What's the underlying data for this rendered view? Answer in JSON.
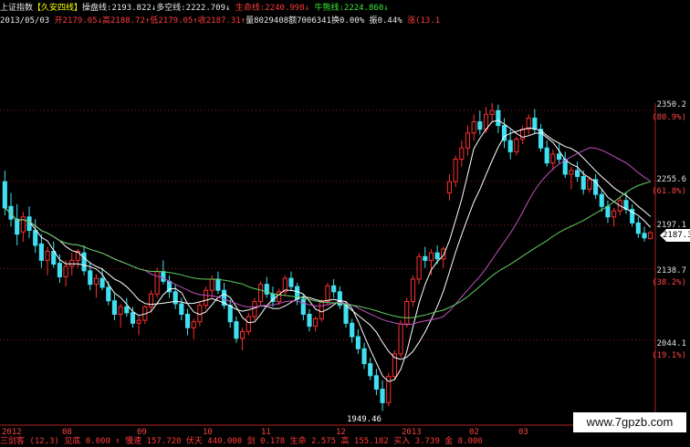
{
  "header": {
    "index_name": "上证指数",
    "formula": "【久安四线】",
    "line1_label": "操盘线:",
    "line1_value": "2193.822",
    "arrow_down": "↓",
    "line2_label": "多空线:",
    "line2_value": "2222.709",
    "line3_label": "生命线:",
    "line3_value": "2240.998",
    "line4_label": "牛熊线:",
    "line4_value": "2224.860"
  },
  "quote": {
    "date": "2013/05/03",
    "open_label": "开",
    "open": "2179.05",
    "high_label": "高",
    "high": "2188.72",
    "low_label": "低",
    "low": "2179.05",
    "close_label": "收",
    "close": "2187.31",
    "vol_label": "量",
    "vol": "8029408",
    "amt_label": "额",
    "amt": "7006341",
    "turn_label": "换",
    "turn": "0.00%",
    "amp_label": "振",
    "amp": "0.44%",
    "chg_label": "涨",
    "chg": "(13.1"
  },
  "y_axis": [
    {
      "price": "2350.2",
      "pct": "(80.9%)"
    },
    {
      "price": "2255.6",
      "pct": "(61.8%)"
    },
    {
      "price": "2197.1"
    },
    {
      "price": "2138.7",
      "pct": "(38.2%)"
    },
    {
      "price": "2044.1",
      "pct": "(19.1%)"
    }
  ],
  "current_price": "2187.3",
  "low_annotation": "1949.46",
  "x_axis": [
    "2012",
    "08",
    "09",
    "10",
    "11",
    "12",
    "2013",
    "02",
    "03"
  ],
  "bottom_text": "三剑客 (12,3)  见底 0.000 ↑  慢速 157.720  伏天 440.000  剑 0.178  生命 2.575  高 155.182  买入 3.739  金 8.000",
  "watermark": "www.7gpzb.com",
  "colors": {
    "up": "#ff3030",
    "down": "#40e0f0",
    "ma_white": "#ffffff",
    "ma_magenta": "#c050c0",
    "ma_green": "#60d060"
  },
  "chart_data": {
    "type": "candlestick",
    "ylim": [
      1930,
      2360
    ],
    "x_ticks": [
      "2012",
      "08",
      "09",
      "10",
      "11",
      "12",
      "2013",
      "02",
      "03"
    ],
    "candles": [
      [
        2255,
        2270,
        2210,
        2220
      ],
      [
        2222,
        2240,
        2195,
        2205
      ],
      [
        2205,
        2225,
        2170,
        2185
      ],
      [
        2188,
        2215,
        2175,
        2208
      ],
      [
        2208,
        2222,
        2180,
        2190
      ],
      [
        2190,
        2205,
        2160,
        2170
      ],
      [
        2172,
        2185,
        2140,
        2150
      ],
      [
        2150,
        2168,
        2130,
        2162
      ],
      [
        2162,
        2175,
        2140,
        2145
      ],
      [
        2146,
        2158,
        2120,
        2128
      ],
      [
        2128,
        2150,
        2115,
        2142
      ],
      [
        2142,
        2160,
        2130,
        2150
      ],
      [
        2150,
        2165,
        2140,
        2162
      ],
      [
        2160,
        2170,
        2130,
        2136
      ],
      [
        2136,
        2148,
        2110,
        2118
      ],
      [
        2118,
        2132,
        2100,
        2126
      ],
      [
        2126,
        2140,
        2110,
        2114
      ],
      [
        2114,
        2122,
        2090,
        2096
      ],
      [
        2096,
        2105,
        2070,
        2078
      ],
      [
        2078,
        2092,
        2060,
        2088
      ],
      [
        2088,
        2100,
        2075,
        2080
      ],
      [
        2080,
        2088,
        2060,
        2066
      ],
      [
        2066,
        2075,
        2050,
        2070
      ],
      [
        2070,
        2090,
        2065,
        2088
      ],
      [
        2088,
        2110,
        2080,
        2105
      ],
      [
        2105,
        2140,
        2100,
        2135
      ],
      [
        2135,
        2150,
        2118,
        2122
      ],
      [
        2122,
        2130,
        2100,
        2108
      ],
      [
        2108,
        2118,
        2085,
        2092
      ],
      [
        2092,
        2100,
        2070,
        2078
      ],
      [
        2078,
        2085,
        2050,
        2060
      ],
      [
        2060,
        2072,
        2045,
        2068
      ],
      [
        2068,
        2095,
        2062,
        2090
      ],
      [
        2090,
        2115,
        2085,
        2110
      ],
      [
        2110,
        2130,
        2100,
        2125
      ],
      [
        2125,
        2135,
        2105,
        2110
      ],
      [
        2110,
        2120,
        2085,
        2090
      ],
      [
        2090,
        2098,
        2060,
        2068
      ],
      [
        2068,
        2075,
        2040,
        2046
      ],
      [
        2046,
        2060,
        2030,
        2055
      ],
      [
        2055,
        2080,
        2050,
        2075
      ],
      [
        2075,
        2100,
        2070,
        2095
      ],
      [
        2095,
        2122,
        2090,
        2118
      ],
      [
        2118,
        2128,
        2100,
        2105
      ],
      [
        2105,
        2115,
        2088,
        2095
      ],
      [
        2095,
        2112,
        2090,
        2108
      ],
      [
        2108,
        2130,
        2102,
        2126
      ],
      [
        2126,
        2135,
        2110,
        2115
      ],
      [
        2115,
        2120,
        2090,
        2098
      ],
      [
        2098,
        2105,
        2070,
        2078
      ],
      [
        2078,
        2085,
        2055,
        2062
      ],
      [
        2062,
        2075,
        2055,
        2072
      ],
      [
        2072,
        2098,
        2068,
        2095
      ],
      [
        2095,
        2120,
        2090,
        2116
      ],
      [
        2116,
        2125,
        2100,
        2108
      ],
      [
        2108,
        2115,
        2085,
        2090
      ],
      [
        2090,
        2095,
        2060,
        2066
      ],
      [
        2066,
        2072,
        2040,
        2048
      ],
      [
        2048,
        2058,
        2025,
        2032
      ],
      [
        2032,
        2040,
        2005,
        2012
      ],
      [
        2012,
        2020,
        1990,
        1996
      ],
      [
        1996,
        2005,
        1970,
        1978
      ],
      [
        1978,
        1990,
        1949,
        1960
      ],
      [
        1960,
        2000,
        1955,
        1995
      ],
      [
        1995,
        2030,
        1990,
        2025
      ],
      [
        2025,
        2070,
        2020,
        2065
      ],
      [
        2065,
        2100,
        2060,
        2095
      ],
      [
        2095,
        2130,
        2088,
        2125
      ],
      [
        2125,
        2160,
        2118,
        2155
      ],
      [
        2155,
        2168,
        2140,
        2150
      ],
      [
        2150,
        2165,
        2130,
        2160
      ],
      [
        2160,
        2170,
        2145,
        2152
      ],
      [
        2152,
        2168,
        2140,
        2165
      ],
      [
        2240,
        2265,
        2230,
        2255
      ],
      [
        2255,
        2290,
        2248,
        2285
      ],
      [
        2285,
        2310,
        2275,
        2300
      ],
      [
        2300,
        2330,
        2290,
        2320
      ],
      [
        2320,
        2345,
        2310,
        2335
      ],
      [
        2335,
        2350,
        2318,
        2325
      ],
      [
        2325,
        2355,
        2320,
        2345
      ],
      [
        2345,
        2360,
        2335,
        2350
      ],
      [
        2350,
        2358,
        2320,
        2330
      ],
      [
        2330,
        2340,
        2300,
        2310
      ],
      [
        2310,
        2325,
        2285,
        2295
      ],
      [
        2295,
        2315,
        2290,
        2312
      ],
      [
        2312,
        2330,
        2305,
        2325
      ],
      [
        2325,
        2345,
        2318,
        2340
      ],
      [
        2340,
        2352,
        2320,
        2325
      ],
      [
        2325,
        2332,
        2295,
        2300
      ],
      [
        2300,
        2310,
        2275,
        2280
      ],
      [
        2280,
        2298,
        2270,
        2292
      ],
      [
        2292,
        2305,
        2280,
        2285
      ],
      [
        2285,
        2295,
        2260,
        2265
      ],
      [
        2265,
        2275,
        2245,
        2270
      ],
      [
        2270,
        2282,
        2255,
        2262
      ],
      [
        2262,
        2270,
        2238,
        2245
      ],
      [
        2245,
        2262,
        2240,
        2258
      ],
      [
        2258,
        2265,
        2232,
        2238
      ],
      [
        2238,
        2245,
        2215,
        2222
      ],
      [
        2222,
        2230,
        2200,
        2208
      ],
      [
        2208,
        2220,
        2195,
        2216
      ],
      [
        2216,
        2235,
        2210,
        2230
      ],
      [
        2230,
        2240,
        2212,
        2218
      ],
      [
        2218,
        2225,
        2195,
        2200
      ],
      [
        2200,
        2208,
        2180,
        2186
      ],
      [
        2186,
        2195,
        2175,
        2180
      ],
      [
        2179,
        2189,
        2179,
        2187
      ]
    ]
  }
}
